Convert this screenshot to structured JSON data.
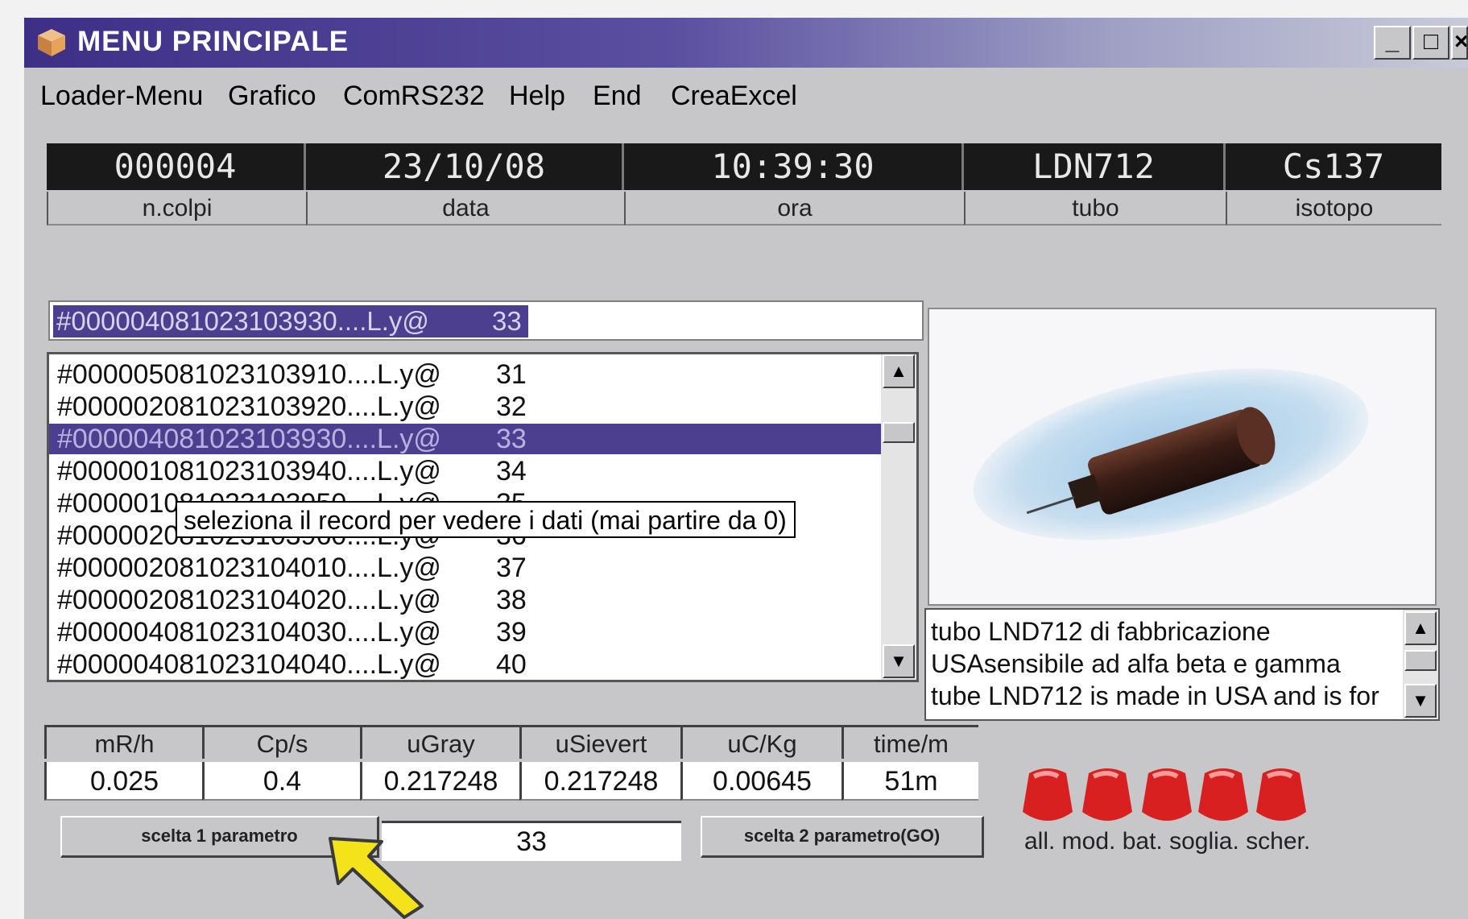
{
  "window": {
    "title": "MENU PRINCIPALE",
    "controls": {
      "minimize": "_",
      "maximize": "□",
      "close": "×"
    }
  },
  "menu": [
    "Loader-Menu",
    "Grafico",
    "ComRS232",
    "Help",
    "End",
    "CreaExcel"
  ],
  "info_fields": [
    {
      "value": "000004",
      "label": "n.colpi"
    },
    {
      "value": "23/10/08",
      "label": "data"
    },
    {
      "value": "10:39:30",
      "label": "ora"
    },
    {
      "value": "LDN712",
      "label": "tubo"
    },
    {
      "value": "Cs137",
      "label": "isotopo"
    }
  ],
  "combo": {
    "record": "#000004081023103930....L.y@",
    "number": "33"
  },
  "records": [
    {
      "record": "#000005081023103910....L.y@",
      "number": "31"
    },
    {
      "record": "#000002081023103920....L.y@",
      "number": "32"
    },
    {
      "record": "#000004081023103930....L.y@",
      "number": "33",
      "selected": true
    },
    {
      "record": "#000001081023103940....L.y@",
      "number": "34"
    },
    {
      "record": "#000001081023103950....L.y@",
      "number": "35"
    },
    {
      "record": "#000002081023103960....L.y@",
      "number": "36"
    },
    {
      "record": "#000002081023104010....L.y@",
      "number": "37"
    },
    {
      "record": "#000002081023104020....L.y@",
      "number": "38"
    },
    {
      "record": "#000004081023104030....L.y@",
      "number": "39"
    },
    {
      "record": "#000004081023104040....L.y@",
      "number": "40"
    }
  ],
  "tooltip": "seleziona il record per vedere i dati (mai partire da 0)",
  "description": [
    "tubo  LND712 di  fabbricazione",
    "USAsensibile ad alfa beta e gamma",
    "tube LND712 is made in USA and is for"
  ],
  "measurements": [
    {
      "label": "mR/h",
      "value": "0.025"
    },
    {
      "label": "Cp/s",
      "value": "0.4"
    },
    {
      "label": "uGray",
      "value": "0.217248"
    },
    {
      "label": "uSievert",
      "value": "0.217248"
    },
    {
      "label": "uC/Kg",
      "value": "0.00645"
    },
    {
      "label": "time/m",
      "value": "51m"
    }
  ],
  "buttons": {
    "param1": "scelta 1 parametro",
    "param_value": "33",
    "param2": "scelta 2 parametro(GO)"
  },
  "indicators_label": "all. mod. bat. soglia. scher.",
  "colors": {
    "titlebar": "#3d2f86",
    "selection": "#4c3f8f",
    "led": "#d92020",
    "window": "#c7c7c9"
  }
}
